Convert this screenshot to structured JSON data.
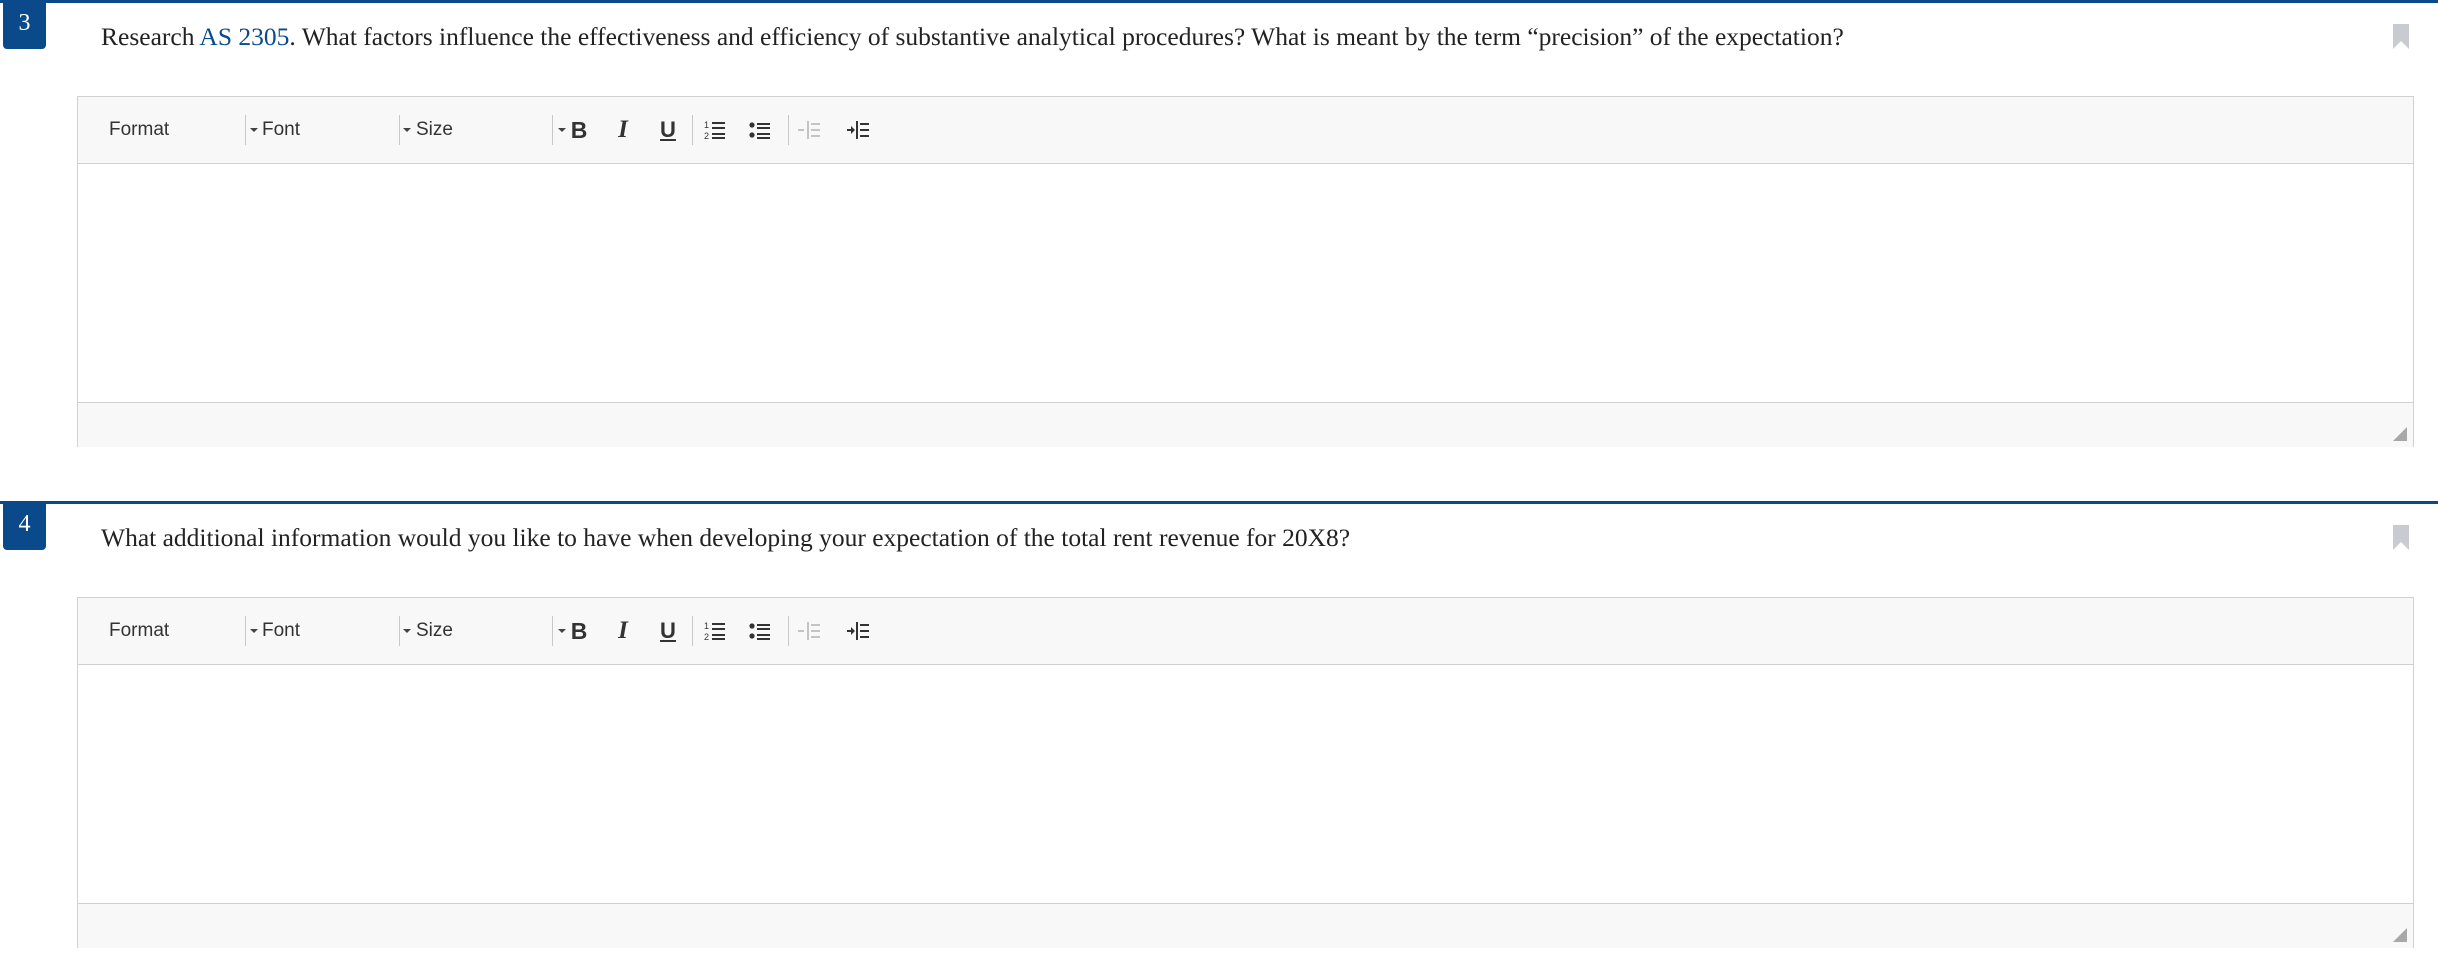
{
  "questions": [
    {
      "number": "3",
      "text_before": "Research ",
      "link_text": "AS 2305",
      "text_after": ". What factors influence the effectiveness and efficiency of substantive analytical procedures? What is meant by the term “precision” of the expectation?",
      "editor": {
        "content": ""
      }
    },
    {
      "number": "4",
      "text_before": "What additional information would you like to have when developing your expectation of the total rent revenue for 20X8?",
      "link_text": "",
      "text_after": "",
      "editor": {
        "content": ""
      }
    }
  ],
  "toolbar": {
    "format_label": "Format",
    "font_label": "Font",
    "size_label": "Size",
    "bold_glyph": "B",
    "italic_glyph": "I",
    "underline_glyph": "U"
  },
  "icons": {
    "bookmark": "bookmark-icon",
    "numbered_list": "numbered-list-icon",
    "bulleted_list": "bulleted-list-icon",
    "decrease_indent": "decrease-indent-icon",
    "increase_indent": "increase-indent-icon",
    "dropdown": "chevron-down-icon",
    "resize": "resize-handle-icon"
  },
  "colors": {
    "accent": "#0a4a8a",
    "bookmark": "#c8ccd0",
    "toolbar_bg": "#f8f8f8",
    "border": "#d1d1d1",
    "text": "#222222"
  }
}
